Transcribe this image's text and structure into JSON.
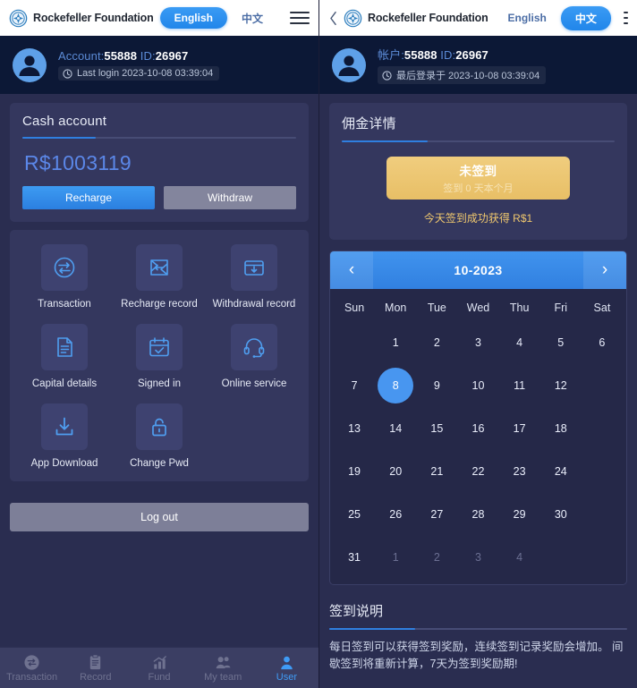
{
  "left": {
    "topbar": {
      "brand": "Rockefeller Foundation",
      "lang_en": "English",
      "lang_zh": "中文",
      "active_lang": "English"
    },
    "account": {
      "label": "Account:",
      "number": "55888",
      "id_label": "ID:",
      "id_value": "26967",
      "last_login": "Last login 2023-10-08 03:39:04"
    },
    "cash_card": {
      "title": "Cash account",
      "balance": "R$1003119",
      "recharge": "Recharge",
      "withdraw": "Withdraw"
    },
    "tiles": [
      {
        "label": "Transaction",
        "icon": "transaction-icon"
      },
      {
        "label": "Recharge record",
        "icon": "recharge-record-icon"
      },
      {
        "label": "Withdrawal record",
        "icon": "withdrawal-record-icon"
      },
      {
        "label": "Capital details",
        "icon": "capital-details-icon"
      },
      {
        "label": "Signed in",
        "icon": "signed-in-icon"
      },
      {
        "label": "Online service",
        "icon": "online-service-icon"
      },
      {
        "label": "App Download",
        "icon": "app-download-icon"
      },
      {
        "label": "Change Pwd",
        "icon": "change-pwd-icon"
      }
    ],
    "logout": "Log out",
    "bottomnav": [
      {
        "label": "Transaction",
        "icon": "transaction-nav-icon",
        "active": false
      },
      {
        "label": "Record",
        "icon": "record-nav-icon",
        "active": false
      },
      {
        "label": "Fund",
        "icon": "fund-nav-icon",
        "active": false
      },
      {
        "label": "My team",
        "icon": "my-team-nav-icon",
        "active": false
      },
      {
        "label": "User",
        "icon": "user-nav-icon",
        "active": true
      }
    ]
  },
  "right": {
    "topbar": {
      "brand": "Rockefeller Foundation",
      "lang_en": "English",
      "lang_zh": "中文",
      "active_lang": "中文"
    },
    "account": {
      "label": "帐户:",
      "number": "55888",
      "id_label": "ID:",
      "id_value": "26967",
      "last_login": "最后登录于 2023-10-08 03:39:04"
    },
    "commission": {
      "title": "佣金详情",
      "signin_main": "未签到",
      "signin_sub": "签到 0 天本个月",
      "note": "今天签到成功获得 R$1"
    },
    "calendar": {
      "prev": "‹",
      "next": "›",
      "month_label": "10-2023",
      "dows": [
        "Sun",
        "Mon",
        "Tue",
        "Wed",
        "Thu",
        "Fri",
        "Sat"
      ],
      "weeks": [
        [
          {
            "d": "",
            "muted": true,
            "today": false
          },
          {
            "d": "1",
            "muted": false,
            "today": false
          },
          {
            "d": "2",
            "muted": false,
            "today": false
          },
          {
            "d": "3",
            "muted": false,
            "today": false
          },
          {
            "d": "4",
            "muted": false,
            "today": false
          },
          {
            "d": "5",
            "muted": false,
            "today": false
          },
          {
            "d": "6",
            "muted": false,
            "today": false
          }
        ],
        [
          {
            "d": "7",
            "muted": false,
            "today": false
          },
          {
            "d": "8",
            "muted": false,
            "today": true
          },
          {
            "d": "9",
            "muted": false,
            "today": false
          },
          {
            "d": "10",
            "muted": false,
            "today": false
          },
          {
            "d": "11",
            "muted": false,
            "today": false
          },
          {
            "d": "12",
            "muted": false,
            "today": false
          },
          {
            "d": "",
            "muted": true,
            "today": false
          }
        ],
        [
          {
            "d": "13",
            "muted": false,
            "today": false
          },
          {
            "d": "14",
            "muted": false,
            "today": false
          },
          {
            "d": "15",
            "muted": false,
            "today": false
          },
          {
            "d": "16",
            "muted": false,
            "today": false
          },
          {
            "d": "17",
            "muted": false,
            "today": false
          },
          {
            "d": "18",
            "muted": false,
            "today": false
          },
          {
            "d": "",
            "muted": true,
            "today": false
          }
        ],
        [
          {
            "d": "19",
            "muted": false,
            "today": false
          },
          {
            "d": "20",
            "muted": false,
            "today": false
          },
          {
            "d": "21",
            "muted": false,
            "today": false
          },
          {
            "d": "22",
            "muted": false,
            "today": false
          },
          {
            "d": "23",
            "muted": false,
            "today": false
          },
          {
            "d": "24",
            "muted": false,
            "today": false
          },
          {
            "d": "",
            "muted": true,
            "today": false
          }
        ],
        [
          {
            "d": "25",
            "muted": false,
            "today": false
          },
          {
            "d": "26",
            "muted": false,
            "today": false
          },
          {
            "d": "27",
            "muted": false,
            "today": false
          },
          {
            "d": "28",
            "muted": false,
            "today": false
          },
          {
            "d": "29",
            "muted": false,
            "today": false
          },
          {
            "d": "30",
            "muted": false,
            "today": false
          },
          {
            "d": "",
            "muted": true,
            "today": false
          }
        ],
        [
          {
            "d": "31",
            "muted": false,
            "today": false
          },
          {
            "d": "1",
            "muted": true,
            "today": false
          },
          {
            "d": "2",
            "muted": true,
            "today": false
          },
          {
            "d": "3",
            "muted": true,
            "today": false
          },
          {
            "d": "4",
            "muted": true,
            "today": false
          },
          {
            "d": "",
            "muted": true,
            "today": false
          },
          {
            "d": "",
            "muted": true,
            "today": false
          }
        ]
      ]
    },
    "description": {
      "title": "签到说明",
      "body": "每日签到可以获得签到奖励，连续签到记录奖励会增加。 间歇签到将重新计算，7天为签到奖励期!"
    }
  },
  "colors": {
    "accent_blue": "#3d9bf2",
    "panel_bg": "#2a2d50",
    "card_bg": "#34375e",
    "account_bg": "#0c1836",
    "gold": "#e8bf66",
    "balance_blue": "#5b87e8"
  }
}
